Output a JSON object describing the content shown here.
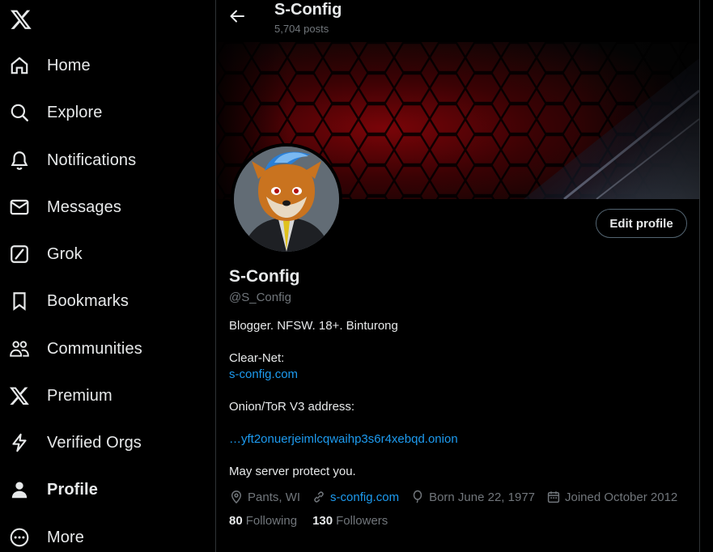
{
  "sidebar": {
    "logo": "x-logo-icon",
    "items": [
      {
        "label": "Home",
        "icon": "home-icon"
      },
      {
        "label": "Explore",
        "icon": "search-icon"
      },
      {
        "label": "Notifications",
        "icon": "bell-icon"
      },
      {
        "label": "Messages",
        "icon": "envelope-icon"
      },
      {
        "label": "Grok",
        "icon": "grok-icon"
      },
      {
        "label": "Bookmarks",
        "icon": "bookmark-icon"
      },
      {
        "label": "Communities",
        "icon": "people-icon"
      },
      {
        "label": "Premium",
        "icon": "x-icon"
      },
      {
        "label": "Verified Orgs",
        "icon": "lightning-icon"
      },
      {
        "label": "Profile",
        "icon": "person-icon",
        "active": true
      },
      {
        "label": "More",
        "icon": "more-circle-icon"
      }
    ]
  },
  "header": {
    "title": "S-Config",
    "posts_count": "5,704 posts"
  },
  "profile": {
    "display_name": "S-Config",
    "handle": "@S_Config",
    "edit_button": "Edit profile",
    "bio": {
      "line1": "Blogger. NFSW. 18+. Binturong",
      "clearnet_label": "Clear-Net:",
      "clearnet_link": "s-config.com",
      "onion_label": "Onion/ToR V3 address:",
      "onion_link": "…yft2onuerjeimlcqwaihp3s6r4xebqd.onion",
      "closing": "May server protect you."
    },
    "meta": {
      "location": "Pants, WI",
      "website": "s-config.com",
      "born": "Born June 22, 1977",
      "joined": "Joined October 2012"
    },
    "stats": {
      "following_count": "80",
      "following_label": "Following",
      "followers_count": "130",
      "followers_label": "Followers"
    }
  },
  "colors": {
    "background": "#000000",
    "text_primary": "#e7e9ea",
    "text_secondary": "#71767b",
    "link": "#1d9bf0",
    "border": "#2f3336",
    "banner_accent": "#8b0000"
  }
}
